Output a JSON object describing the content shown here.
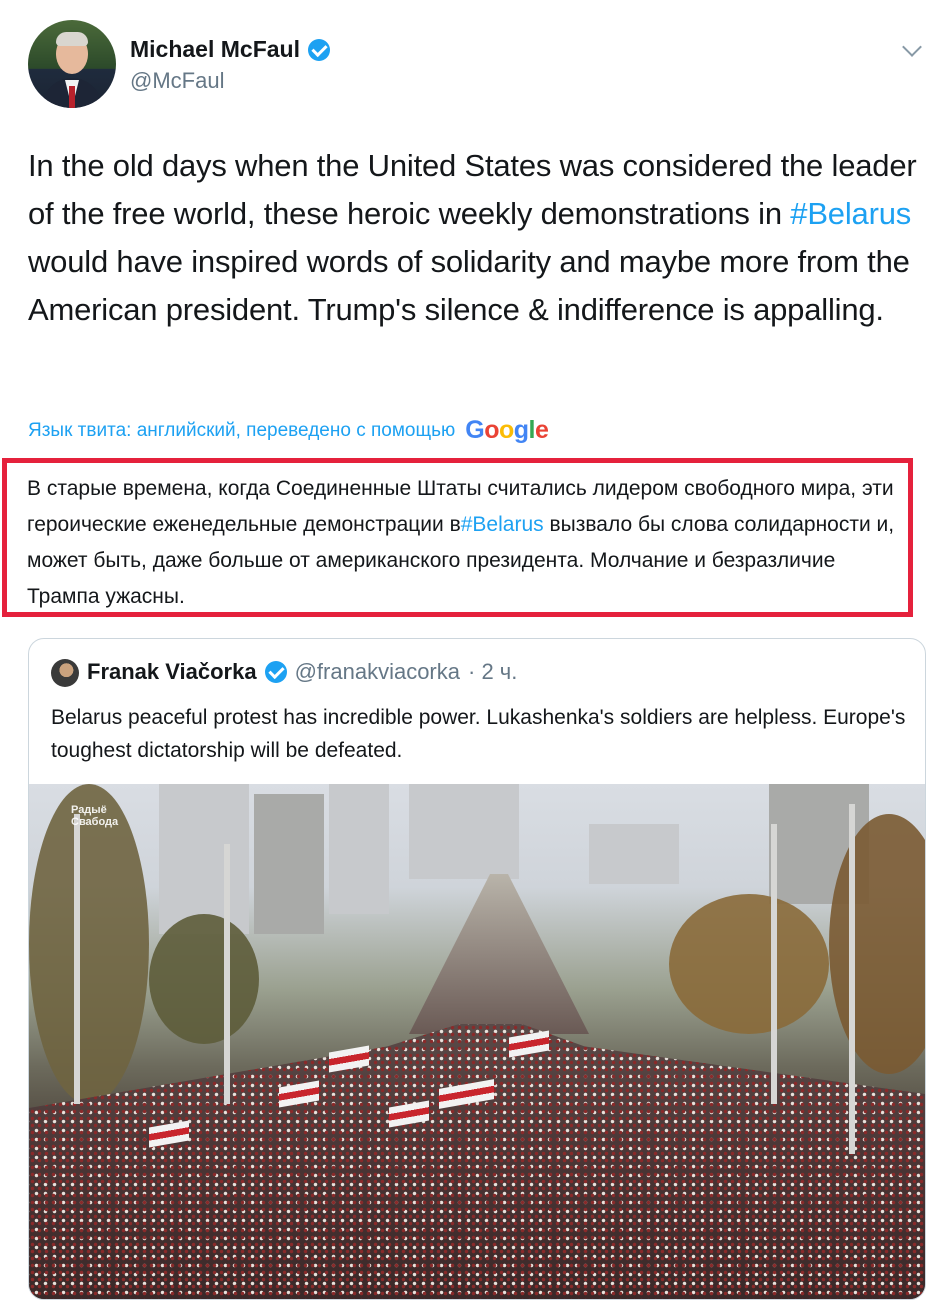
{
  "author": {
    "name": "Michael McFaul",
    "handle": "@McFaul"
  },
  "tweet": {
    "text_before": "In the old days when the United States was considered the leader of the free world, these heroic weekly demonstrations in ",
    "hashtag": "#Belarus",
    "text_after": "  would have inspired words of solidarity and maybe more from the American president. Trump's silence & indifference is appalling."
  },
  "translation": {
    "label": "Язык твита: английский, переведено с помощью",
    "provider": "Google",
    "text_before": "В старые времена, когда Соединенные Штаты считались лидером свободного мира, эти героические еженедельные демонстрации в",
    "hashtag": "#Belarus",
    "text_after": " вызвало бы слова солидарности и, может быть, даже больше от американского президента. Молчание и безразличие Трампа ужасны."
  },
  "quoted_tweet": {
    "name": "Franak Viačorka",
    "handle": "@franakviacorka",
    "time": "· 2 ч.",
    "text": "Belarus peaceful protest has incredible power. Lukashenka's soldiers are helpless. Europe's toughest dictatorship will be defeated.",
    "media_logo_line1": "Радыё",
    "media_logo_line2": "Свабода"
  },
  "colors": {
    "accent": "#1da1f2",
    "highlight_border": "#e5213c"
  },
  "icons": {
    "verified": "verified-badge-icon",
    "menu": "chevron-down-icon"
  }
}
